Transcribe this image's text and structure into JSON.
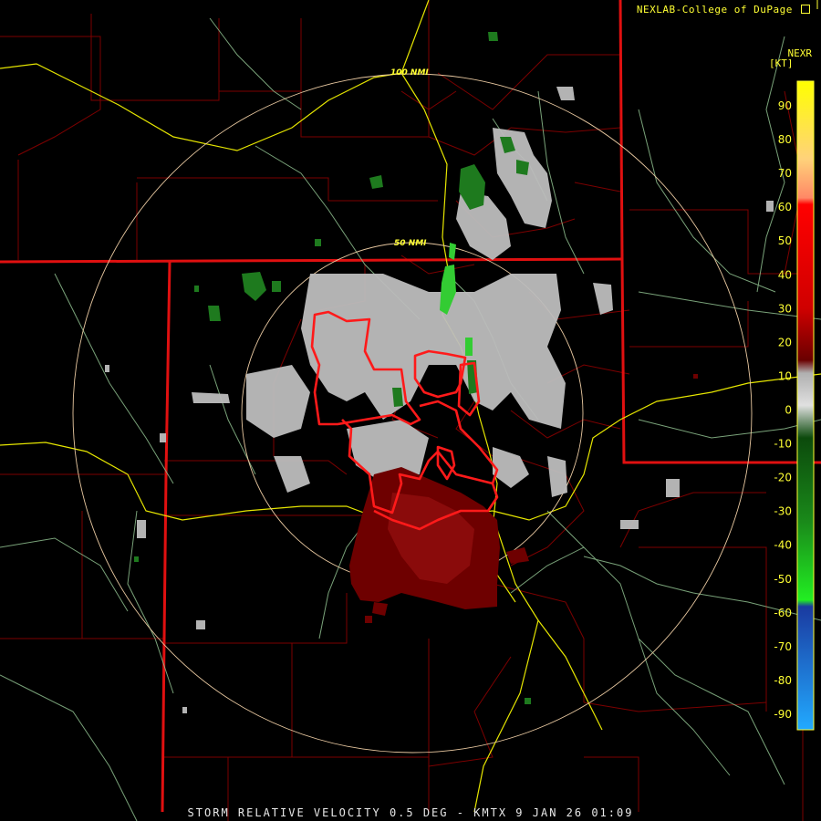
{
  "header": {
    "credit": "NEXLAB-College of DuPage",
    "credit_icon": "external-link-icon",
    "product": "NEXR",
    "units": "[KT]"
  },
  "rings": [
    {
      "label": "50 NMI"
    },
    {
      "label": "100 NMI"
    }
  ],
  "legend": {
    "ticks": [
      "90",
      "80",
      "70",
      "60",
      "50",
      "40",
      "30",
      "20",
      "10",
      "0",
      "-10",
      "-20",
      "-30",
      "-40",
      "-50",
      "-60",
      "-70",
      "-80",
      "-90"
    ],
    "colors": {
      "inbound_strong": "#1e90ff",
      "inbound": "#1e7a1e",
      "bright_green": "#22dd22",
      "neutral": "#c0c0c0",
      "outbound": "#7a0000",
      "outbound_strong": "#ff1a1a",
      "peak": "#ff9966",
      "max": "#ffff00"
    }
  },
  "footer": {
    "title": "STORM RELATIVE VELOCITY 0.5 DEG - KMTX 9 JAN 26 01:09"
  }
}
